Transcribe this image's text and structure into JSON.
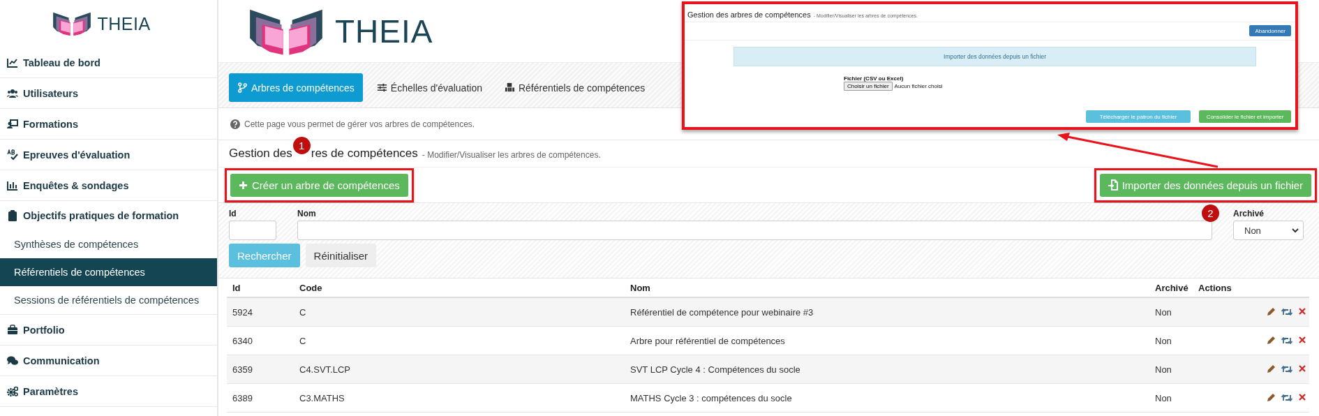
{
  "sidebar": {
    "logo": "THEIA",
    "items": [
      {
        "label": "Tableau de bord",
        "selected": false
      },
      {
        "label": "Utilisateurs",
        "selected": false
      },
      {
        "label": "Formations",
        "selected": false
      },
      {
        "label": "Epreuves d'évaluation",
        "selected": false
      },
      {
        "label": "Enquêtes & sondages",
        "selected": false
      },
      {
        "label": "Objectifs pratiques de formation",
        "selected": false,
        "children": [
          {
            "label": "Synthèses de compétences",
            "selected": false
          },
          {
            "label": "Référentiels de compétences",
            "selected": true
          },
          {
            "label": "Sessions de référentiels de compétences",
            "selected": false
          }
        ]
      },
      {
        "label": "Portfolio",
        "selected": false
      },
      {
        "label": "Communication",
        "selected": false
      },
      {
        "label": "Paramètres",
        "selected": false
      }
    ]
  },
  "header": {
    "logo": "THEIA"
  },
  "tabs": [
    {
      "label": "Arbres de compétences",
      "selected": true
    },
    {
      "label": "Échelles d'évaluation",
      "selected": false
    },
    {
      "label": "Référentiels de compétences",
      "selected": false
    }
  ],
  "info": "Cette page vous permet de gérer vos arbres de compétences.",
  "heading": {
    "title_before": "Gestion des",
    "title_after": "res de compétences",
    "subtitle": "- Modifier/Visualiser les arbres de compétences."
  },
  "annotations": [
    "1",
    "2"
  ],
  "buttons": {
    "create": "Créer un arbre de compétences",
    "import": "Importer des données depuis un fichier"
  },
  "filters": {
    "id_label": "Id",
    "name_label": "Nom",
    "archived_label": "Archivé",
    "archived_value": "Non",
    "search": "Rechercher",
    "reset": "Réinitialiser"
  },
  "table": {
    "columns": [
      "Id",
      "Code",
      "Nom",
      "Archivé",
      "Actions"
    ],
    "rows": [
      {
        "id": "5924",
        "code": "C",
        "name": "Référentiel de compétence pour webinaire #3",
        "archived": "Non"
      },
      {
        "id": "6340",
        "code": "C",
        "name": "Arbre pour référentiel de compétences",
        "archived": "Non"
      },
      {
        "id": "6359",
        "code": "C4.SVT.LCP",
        "name": "SVT LCP Cycle 4 : Compétences du socle",
        "archived": "Non"
      },
      {
        "id": "6389",
        "code": "C3.MATHS",
        "name": "MATHS Cycle 3 : compétences du socle",
        "archived": "Non"
      }
    ]
  },
  "inset": {
    "title": "Gestion des arbres de compétences",
    "subtitle": "- Modifier/Visualiser les arbres de compétences.",
    "cancel": "Abandonner",
    "banner": "Importer des données depuis un fichier",
    "file_label": "Fichier (CSV ou Excel)",
    "file_button": "Choisir un fichier",
    "file_status": "Aucun fichier choisi",
    "download": "Télécharger le patron du fichier",
    "confirm": "Consolider le fichier et importer"
  }
}
